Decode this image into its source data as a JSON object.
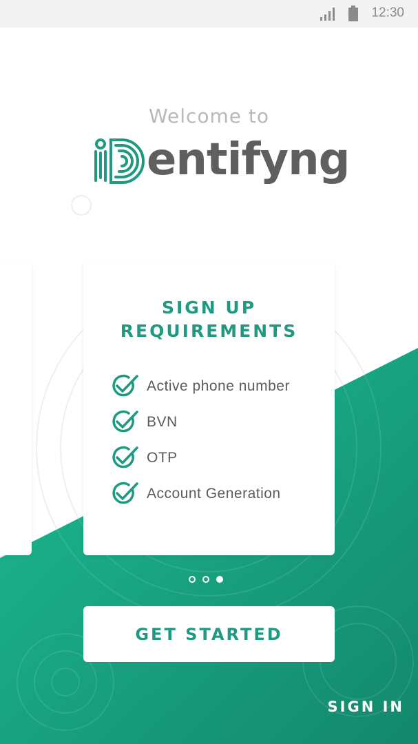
{
  "status_bar": {
    "time": "12:30"
  },
  "header": {
    "welcome_text": "Welcome to",
    "brand_name": "entifyng"
  },
  "card": {
    "title_line1": "SIGN UP",
    "title_line2": "REQUIREMENTS",
    "requirements": [
      "Active phone number",
      "BVN",
      "OTP",
      "Account Generation"
    ]
  },
  "pager": {
    "total": 3,
    "active_index": 2
  },
  "actions": {
    "get_started_label": "GET STARTED",
    "sign_in_label": "SIGN IN"
  },
  "colors": {
    "accent": "#1f9a80",
    "accent_light": "#1dbd95",
    "accent_dark": "#15896d",
    "text_gray": "#5f5f5f"
  },
  "icons": [
    "signal-icon",
    "battery-icon",
    "check-circle-icon",
    "fingerprint-logo-icon"
  ]
}
